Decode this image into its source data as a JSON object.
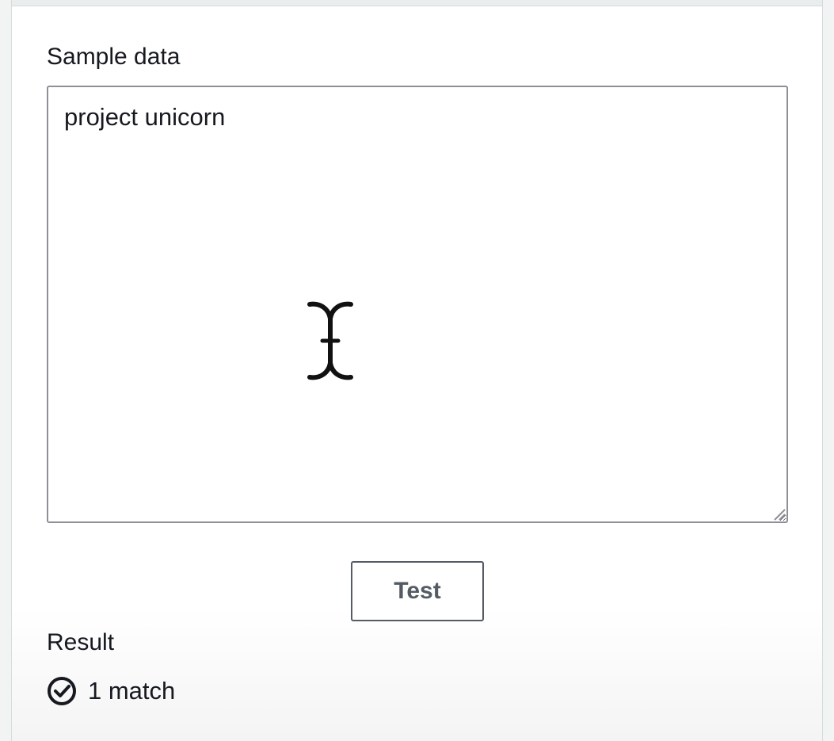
{
  "sample": {
    "label": "Sample data",
    "value": "project unicorn"
  },
  "actions": {
    "test_label": "Test"
  },
  "result": {
    "label": "Result",
    "status_icon": "check-circle-icon",
    "match_text": "1 match"
  },
  "pointer": {
    "icon": "text-cursor-icon"
  },
  "colors": {
    "text": "#16191f",
    "border": "#8d9096",
    "button_border": "#545b64",
    "panel_background": "#ffffff",
    "page_background": "#f2f3f3"
  }
}
